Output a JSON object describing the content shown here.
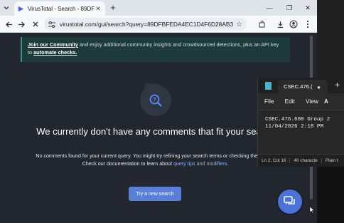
{
  "browser": {
    "tab_title": "VirusTotal - Search - 89DFBFED",
    "tab_close": "✕",
    "new_tab": "+",
    "url": "virustotal.com/gui/search?query=89DFBFEDA4EC1D4F6D28AB376CC2...",
    "window_controls": {
      "minimize": "—",
      "restore": "❐",
      "close": "✕"
    },
    "icons": [
      "tab-list-icon",
      "back-arrow-icon",
      "stop-loading-icon",
      "site-info-icon",
      "bookmark-star-icon",
      "extensions-icon",
      "download-icon",
      "profile-icon",
      "more-menu-icon"
    ]
  },
  "page": {
    "banner": {
      "link_join": "Join our Community",
      "text_main": " and enjoy additional community insights and crowdsourced detections, plus an API key",
      "text_to": "to ",
      "link_automate": "automate checks."
    },
    "empty_state": {
      "title": "We currently don't have any comments that fit your search",
      "line1": "No comments found for your current query. You might try refining your search terms or checking the syntax.",
      "line2_prefix": "Check our documentation to learn about ",
      "line2_link": "query tips and modifiers",
      "line2_suffix": ".",
      "button": "Try a new search",
      "icon": "search-comment-icon"
    },
    "chat_icon": "chat-bubble-icon"
  },
  "notepad": {
    "tab_title": "CSEC.476.(",
    "tab_dot": "●",
    "new_tab": "+",
    "menu": [
      "File",
      "Edit",
      "View"
    ],
    "format_icon": "A",
    "content": "CSEC.476.600 Group 2\n11/04/2026 2:18 PM",
    "status": [
      "Ln 2, Col 16",
      "40 characte",
      "Plain t"
    ]
  },
  "colors": {
    "page_bg": "#22262e",
    "banner_bg": "#1d3b3b",
    "accent_blue": "#5b7fd6",
    "link_blue": "#8fb2ff"
  }
}
